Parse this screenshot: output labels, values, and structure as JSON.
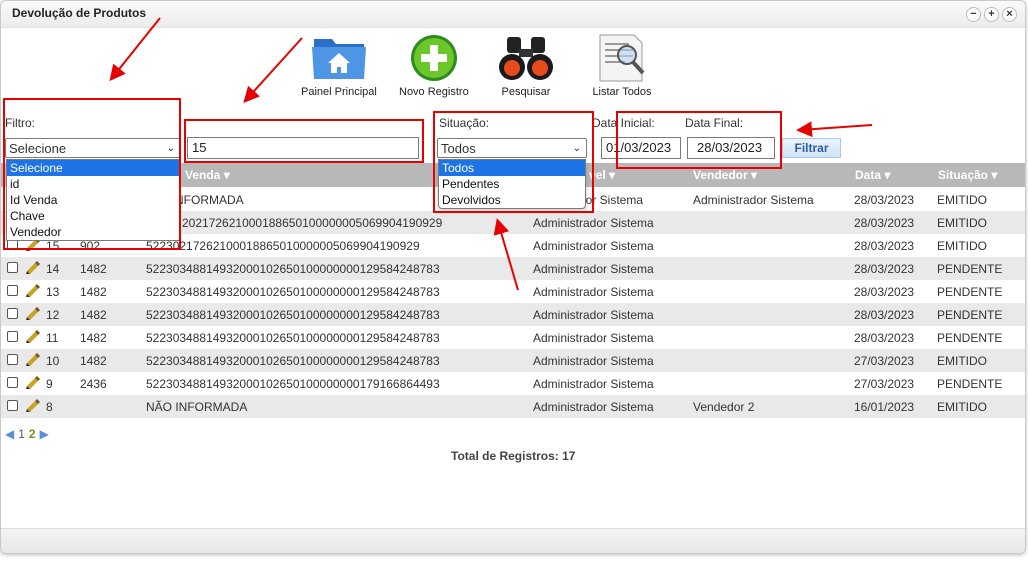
{
  "window": {
    "title": "Devolução de Produtos",
    "controls": [
      "−",
      "+",
      "×"
    ]
  },
  "toolbar": {
    "home": "Painel Principal",
    "new": "Novo Registro",
    "search": "Pesquisar",
    "list_all": "Listar Todos"
  },
  "filter": {
    "label": "Filtro:",
    "selected": "Selecione",
    "options": [
      "Selecione",
      "id",
      "Id Venda",
      "Chave",
      "Vendedor"
    ],
    "text_value": "15"
  },
  "situacao": {
    "label": "Situação:",
    "selected": "Todos",
    "options": [
      "Todos",
      "Pendentes",
      "Devolvidos"
    ]
  },
  "dates": {
    "initial_label": "Data Inicial:",
    "initial_value": "01/03/2023",
    "final_label": "Data Final:",
    "final_value": "28/03/2023"
  },
  "filter_button": "Filtrar",
  "columns": {
    "venda": "Venda",
    "responsavel": "vel",
    "vendedor": "Vendedor",
    "data": "Data",
    "situacao": "Situação"
  },
  "rows": [
    {
      "id": "",
      "venda": "",
      "chave": "NFORMADA",
      "responsavel": "dor Sistema",
      "vendedor": "Administrador Sistema",
      "data": "28/03/2023",
      "situacao": "EMITIDO"
    },
    {
      "id": "",
      "venda": "",
      "chave": "2021726210001886501000000050699041909​29",
      "responsavel": "Administrador Sistema",
      "vendedor": "",
      "data": "28/03/2023",
      "situacao": "EMITIDO"
    },
    {
      "id": "15",
      "venda": "902",
      "chave": "52230217262100018865010000005069904190929",
      "responsavel": "Administrador Sistema",
      "vendedor": "",
      "data": "28/03/2023",
      "situacao": "EMITIDO"
    },
    {
      "id": "14",
      "venda": "1482",
      "chave": "52230348814932000102650100000000129584248783",
      "responsavel": "Administrador Sistema",
      "vendedor": "",
      "data": "28/03/2023",
      "situacao": "PENDENTE"
    },
    {
      "id": "13",
      "venda": "1482",
      "chave": "52230348814932000102650100000000129584248783",
      "responsavel": "Administrador Sistema",
      "vendedor": "",
      "data": "28/03/2023",
      "situacao": "PENDENTE"
    },
    {
      "id": "12",
      "venda": "1482",
      "chave": "52230348814932000102650100000000129584248783",
      "responsavel": "Administrador Sistema",
      "vendedor": "",
      "data": "28/03/2023",
      "situacao": "PENDENTE"
    },
    {
      "id": "11",
      "venda": "1482",
      "chave": "52230348814932000102650100000000129584248783",
      "responsavel": "Administrador Sistema",
      "vendedor": "",
      "data": "28/03/2023",
      "situacao": "PENDENTE"
    },
    {
      "id": "10",
      "venda": "1482",
      "chave": "52230348814932000102650100000000129584248783",
      "responsavel": "Administrador Sistema",
      "vendedor": "",
      "data": "27/03/2023",
      "situacao": "EMITIDO"
    },
    {
      "id": "9",
      "venda": "2436",
      "chave": "52230348814932000102650100000000179166864493",
      "responsavel": "Administrador Sistema",
      "vendedor": "",
      "data": "27/03/2023",
      "situacao": "PENDENTE"
    },
    {
      "id": "8",
      "venda": "",
      "chave": "NÃO INFORMADA",
      "responsavel": "Administrador Sistema",
      "vendedor": "Vendedor 2",
      "data": "16/01/2023",
      "situacao": "EMITIDO"
    }
  ],
  "pager": {
    "pages": [
      "1",
      "2"
    ],
    "current": "2"
  },
  "total": "Total de Registros: 17",
  "colors": {
    "highlight": "#1e73e6",
    "annotation": "#e60000",
    "header_bg": "#b8b8b8"
  }
}
